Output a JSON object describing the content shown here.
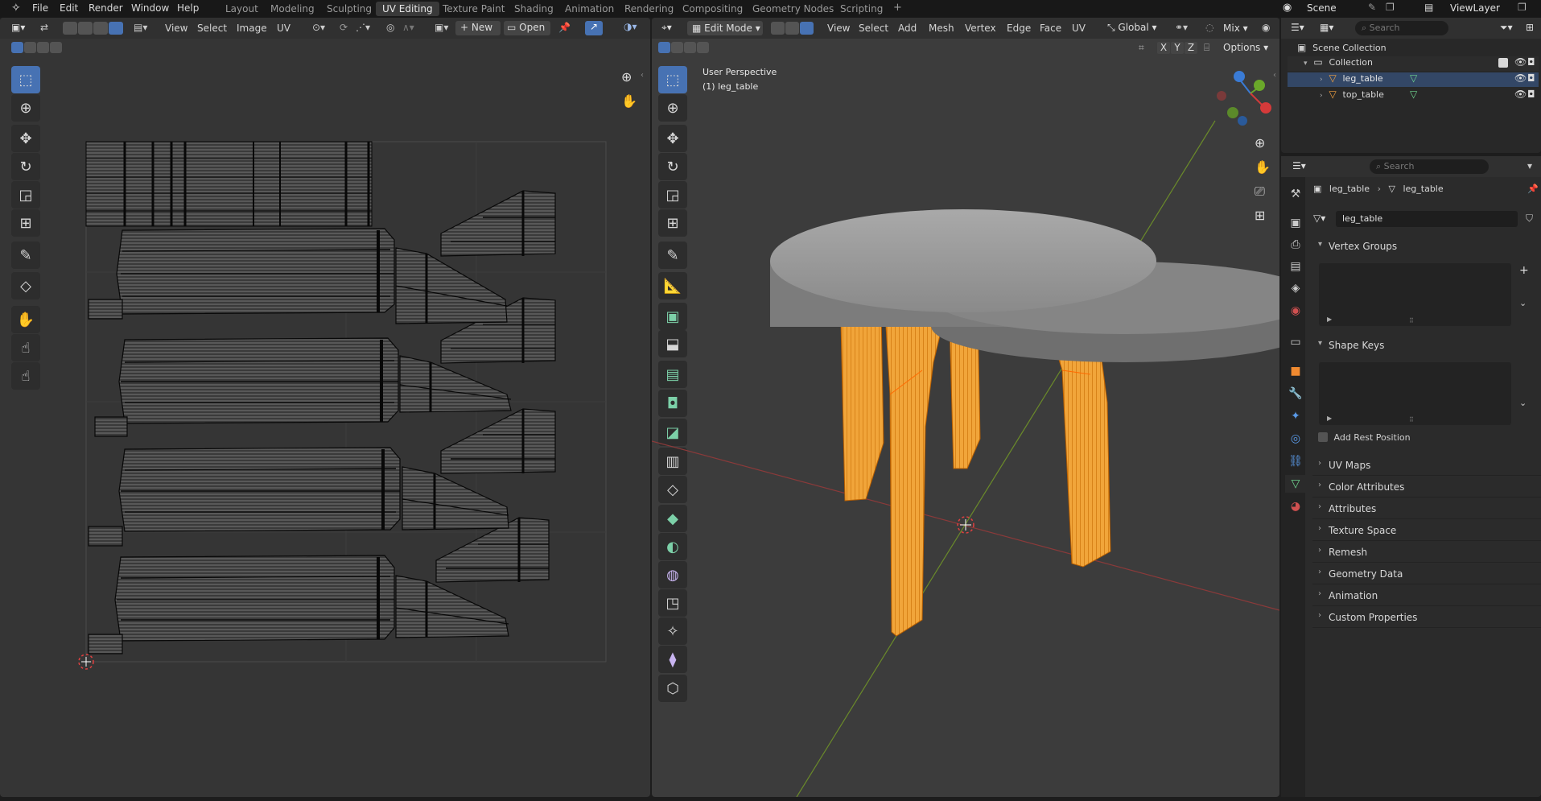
{
  "topbar": {
    "menus": [
      "File",
      "Edit",
      "Render",
      "Window",
      "Help"
    ],
    "workspaces": [
      "Layout",
      "Modeling",
      "Sculpting",
      "UV Editing",
      "Texture Paint",
      "Shading",
      "Animation",
      "Rendering",
      "Compositing",
      "Geometry Nodes",
      "Scripting"
    ],
    "active_workspace": "UV Editing",
    "add_tab": "+",
    "scene": "Scene",
    "view_layer": "ViewLayer"
  },
  "uv_editor": {
    "menus": [
      "View",
      "Select",
      "Image",
      "UV"
    ],
    "new_label": "New",
    "open_label": "Open"
  },
  "viewport": {
    "mode": "Edit Mode",
    "menus": [
      "View",
      "Select",
      "Add",
      "Mesh",
      "Vertex",
      "Edge",
      "Face",
      "UV"
    ],
    "transform_orientation": "Global",
    "overlay_mix": "Mix",
    "axes": [
      "X",
      "Y",
      "Z"
    ],
    "options_label": "Options",
    "perspective_label": "User Perspective",
    "object_label": "(1) leg_table"
  },
  "outliner": {
    "search_placeholder": "Search",
    "scene_collection": "Scene Collection",
    "collection": "Collection",
    "objects": [
      "leg_table",
      "top_table"
    ]
  },
  "properties": {
    "search_placeholder": "Search",
    "breadcrumb_object": "leg_table",
    "breadcrumb_mesh": "leg_table",
    "mesh_name": "leg_table",
    "vertex_groups": "Vertex Groups",
    "shape_keys": "Shape Keys",
    "add_rest_position": "Add Rest Position",
    "sections": [
      "UV Maps",
      "Color Attributes",
      "Attributes",
      "Texture Space",
      "Remesh",
      "Geometry Data",
      "Animation",
      "Custom Properties"
    ]
  },
  "colors": {
    "accent": "#4772b3",
    "selection": "#ff9a1e",
    "mesh_green": "#6fd48f"
  }
}
